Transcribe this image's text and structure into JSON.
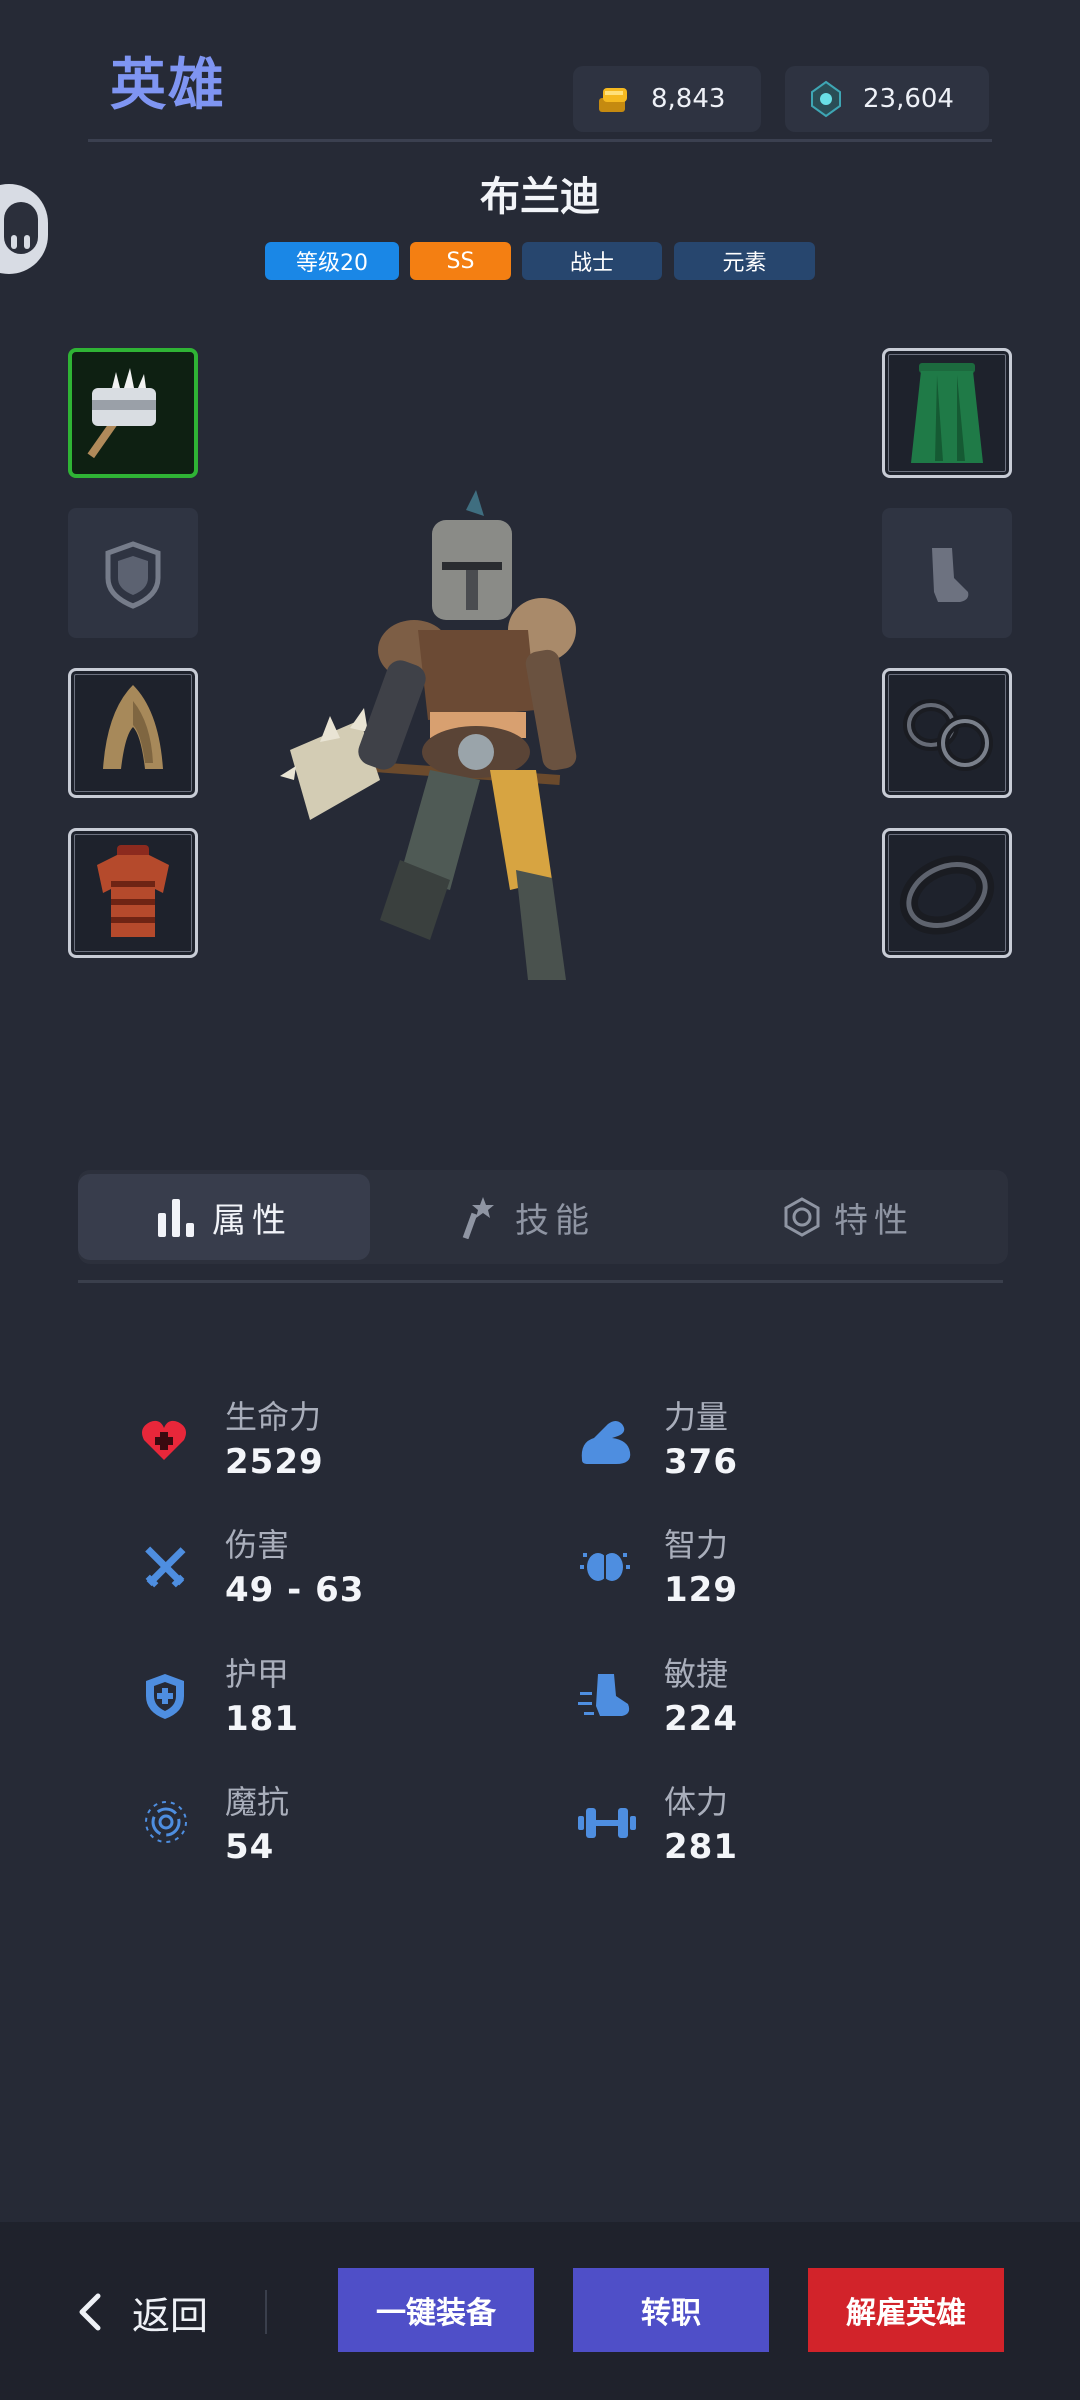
{
  "header": {
    "title": "英雄",
    "gold": "8,843",
    "gems": "23,604"
  },
  "hero": {
    "name": "布兰迪",
    "tags": [
      "等级20",
      "SS",
      "战士",
      "元素"
    ]
  },
  "equipment": {
    "left": [
      "hammer",
      "shield-empty",
      "hood",
      "leather-armor"
    ],
    "right": [
      "cloak",
      "boots-empty",
      "rings",
      "amulet"
    ]
  },
  "tabs": [
    "属性",
    "技能",
    "特性"
  ],
  "stats": {
    "vitality": {
      "label": "生命力",
      "value": "2529"
    },
    "damage": {
      "label": "伤害",
      "value": "49 - 63"
    },
    "armor": {
      "label": "护甲",
      "value": "181"
    },
    "magic_resist": {
      "label": "魔抗",
      "value": "54"
    },
    "strength": {
      "label": "力量",
      "value": "376"
    },
    "intellect": {
      "label": "智力",
      "value": "129"
    },
    "agility": {
      "label": "敏捷",
      "value": "224"
    },
    "stamina": {
      "label": "体力",
      "value": "281"
    }
  },
  "bottom": {
    "back": "返回",
    "equip_all": "一键装备",
    "change_class": "转职",
    "dismiss": "解雇英雄"
  },
  "colors": {
    "accent": "#7f95f2",
    "level_tag": "#1a87e6",
    "rank_tag": "#f47f12",
    "class_tag": "#27466e",
    "button_blue": "#4f4fc8",
    "button_red": "#d2232a",
    "equipped_border": "#2fb335"
  }
}
